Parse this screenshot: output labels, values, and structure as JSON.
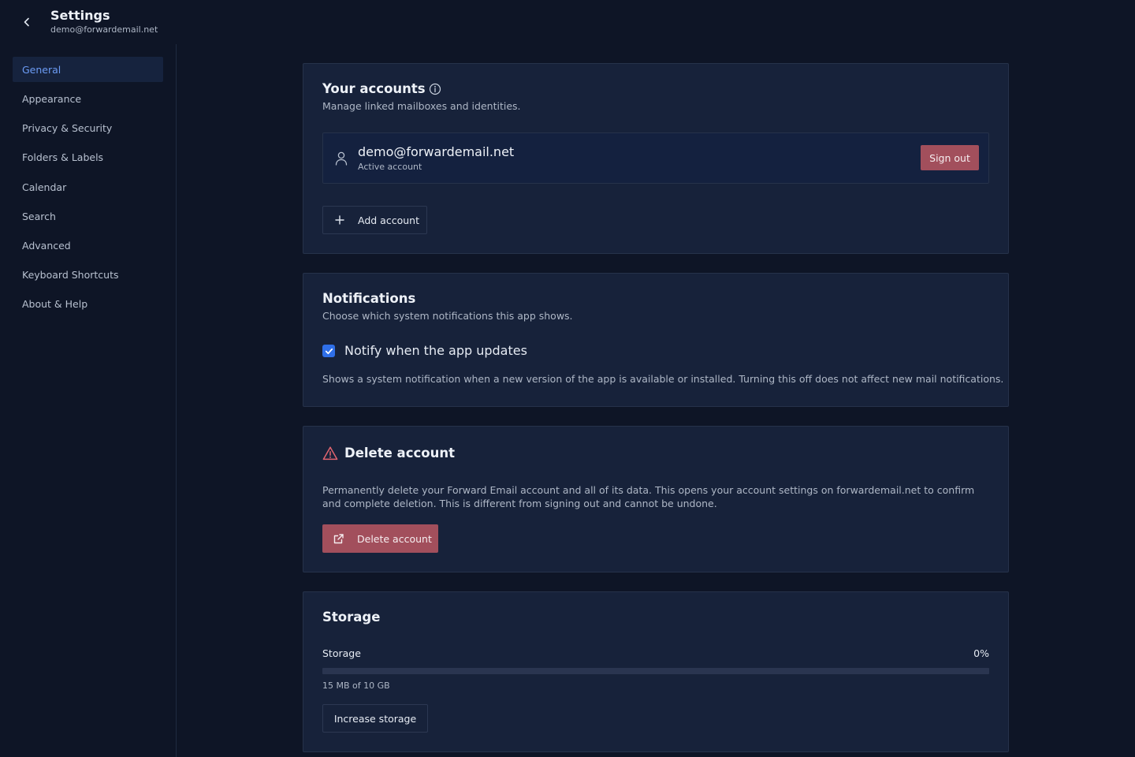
{
  "header": {
    "title": "Settings",
    "subtitle": "demo@forwardemail.net",
    "back_icon": "chevron-left-icon"
  },
  "sidebar": {
    "items": [
      {
        "label": "General",
        "active": true
      },
      {
        "label": "Appearance",
        "active": false
      },
      {
        "label": "Privacy & Security",
        "active": false
      },
      {
        "label": "Folders & Labels",
        "active": false
      },
      {
        "label": "Calendar",
        "active": false
      },
      {
        "label": "Search",
        "active": false
      },
      {
        "label": "Advanced",
        "active": false
      },
      {
        "label": "Keyboard Shortcuts",
        "active": false
      },
      {
        "label": "About & Help",
        "active": false
      }
    ]
  },
  "accounts": {
    "title": "Your accounts",
    "description": "Manage linked mailboxes and identities.",
    "account": {
      "email": "demo@forwardemail.net",
      "status": "Active account",
      "sign_out_label": "Sign out"
    },
    "add_account_label": "Add account"
  },
  "notifications": {
    "title": "Notifications",
    "description": "Choose which system notifications this app shows.",
    "notify_updates": {
      "label": "Notify when the app updates",
      "checked": true,
      "help": "Shows a system notification when a new version of the app is available or installed. Turning this off does not affect new mail notifications."
    }
  },
  "delete_account": {
    "title": "Delete account",
    "description": "Permanently delete your Forward Email account and all of its data. This opens your account settings on forwardemail.net to confirm and complete deletion. This is different from signing out and cannot be undone.",
    "button_label": "Delete account"
  },
  "storage": {
    "title": "Storage",
    "label": "Storage",
    "percent_text": "0%",
    "used_fraction": 0.0,
    "usage_text": "15 MB of 10 GB",
    "increase_label": "Increase storage"
  },
  "colors": {
    "background": "#0e1526",
    "card": "#17223a",
    "accent": "#2f6fe8",
    "active_nav_text": "#6c9cf5",
    "danger": "#a24f5c",
    "warning_icon": "#e0646f"
  }
}
